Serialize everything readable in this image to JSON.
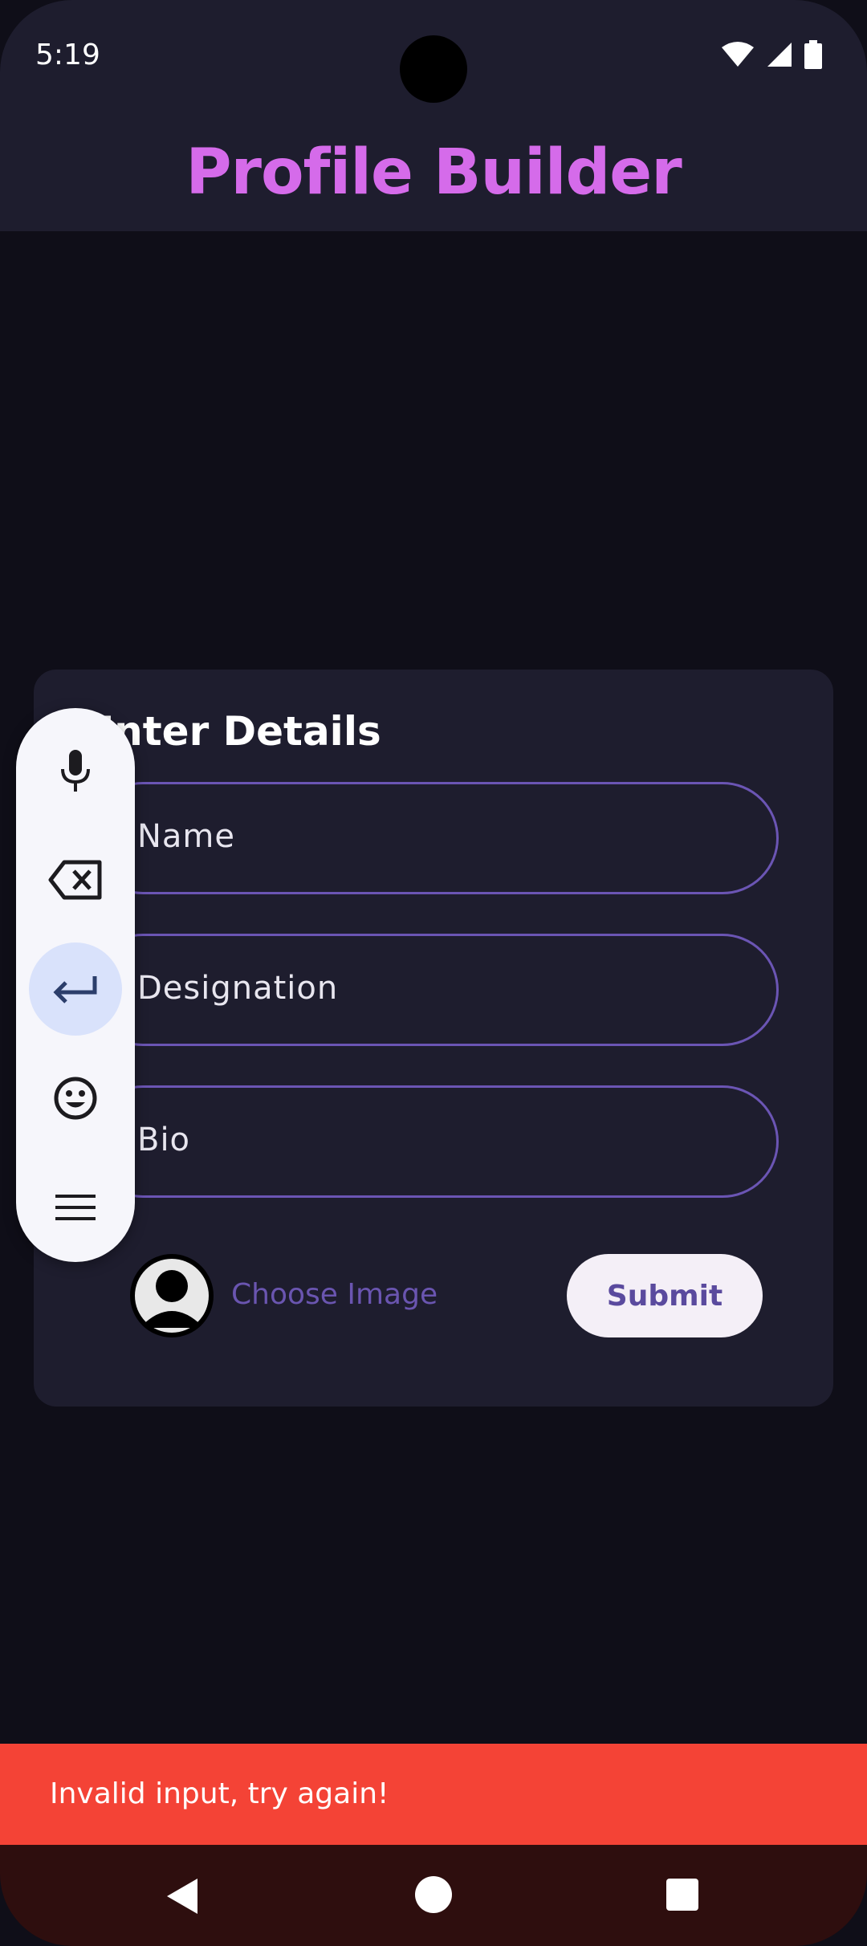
{
  "status_bar": {
    "time": "5:19"
  },
  "app_bar": {
    "title": "Profile Builder"
  },
  "form": {
    "title": "Enter Details",
    "fields": [
      {
        "label": "Name"
      },
      {
        "label": "Designation"
      },
      {
        "label": "Bio"
      }
    ],
    "choose_image_label": "Choose Image",
    "submit_label": "Submit"
  },
  "keyboard_toolbar": {
    "items": [
      "mic-icon",
      "backspace-icon",
      "enter-icon",
      "emoji-icon",
      "menu-icon"
    ],
    "active_item": "enter-icon"
  },
  "snackbar": {
    "message": "Invalid input, try again!"
  },
  "colors": {
    "accent": "#d56bea",
    "field_border": "#6b55b4",
    "snackbar": "#f44336",
    "card": "#1e1d2e",
    "background": "#0f0e18"
  }
}
